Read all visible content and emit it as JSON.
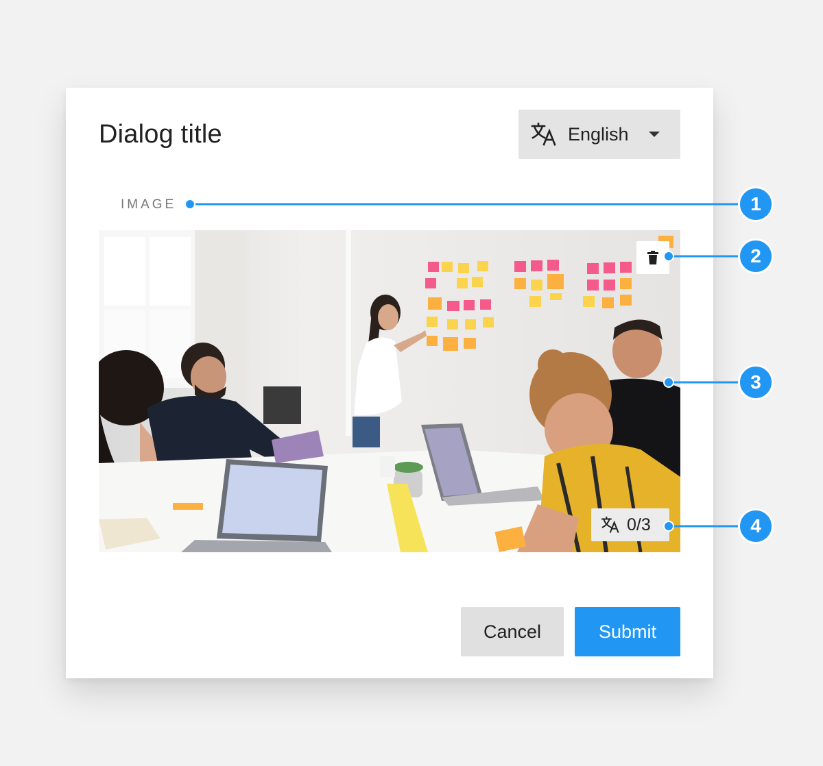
{
  "dialog": {
    "title": "Dialog title",
    "language_select": {
      "value": "English",
      "icon": "translate-icon"
    },
    "section_label": "IMAGE",
    "image": {
      "alt_description": "",
      "delete_icon": "trash-icon",
      "translation_badge": {
        "icon": "translate-icon",
        "count": "0/3"
      }
    },
    "buttons": {
      "cancel": "Cancel",
      "submit": "Submit"
    }
  },
  "callouts": [
    "1",
    "2",
    "3",
    "4"
  ],
  "colors": {
    "accent": "#2196f3",
    "dialog_bg": "#ffffff",
    "page_bg": "#f2f2f2",
    "select_bg": "#e4e4e4",
    "cancel_bg": "#e0e0e0"
  }
}
